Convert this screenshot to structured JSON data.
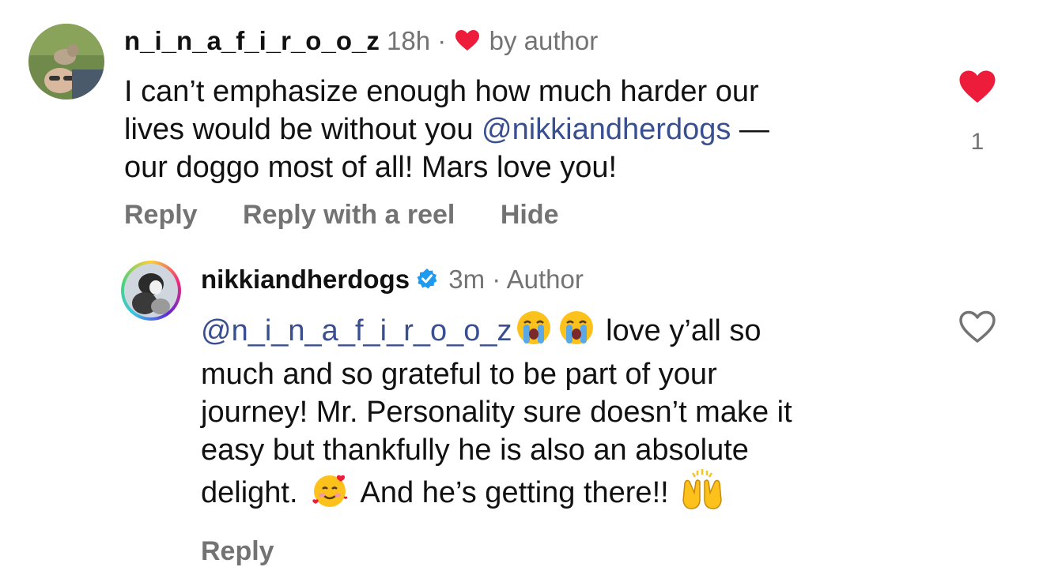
{
  "comments": [
    {
      "username": "n_i_n_a_f_i_r_o_o_z",
      "time": "18h",
      "separator": "·",
      "liked_by_author_label": "by author",
      "text_lines": [
        "I can’t emphasize enough how much harder our",
        "lives would be without you ",
        "our doggo most of all! Mars love you!"
      ],
      "mention": "@nikkiandherdogs",
      "line2_suffix": " —",
      "actions": [
        "Reply",
        "Reply with a reel",
        "Hide"
      ],
      "like_count": "1",
      "liked": true
    },
    {
      "username": "nikkiandherdogs",
      "verified": true,
      "time": "3m",
      "separator": "·",
      "author_label": "Author",
      "mention": "@n_i_n_a_f_i_r_o_o_z",
      "text_line1_after": " love y’all so",
      "text_lines": [
        "much and so grateful to be part of your",
        "journey! Mr. Personality sure doesn’t make it",
        "easy but thankfully he is also an absolute"
      ],
      "text_last_a": "delight. ",
      "text_last_b": " And he’s getting there!! ",
      "actions": [
        "Reply"
      ],
      "liked": false
    }
  ],
  "colors": {
    "heart_red": "#ed1c3a",
    "mention_blue": "#3a4f8f",
    "verified_blue": "#1d9bf0",
    "gray_text": "#737373"
  },
  "icons": [
    "heart-icon",
    "heart-outline-icon",
    "verified-badge-icon",
    "loudly-crying-emoji",
    "smiling-hearts-emoji",
    "raising-hands-emoji"
  ]
}
